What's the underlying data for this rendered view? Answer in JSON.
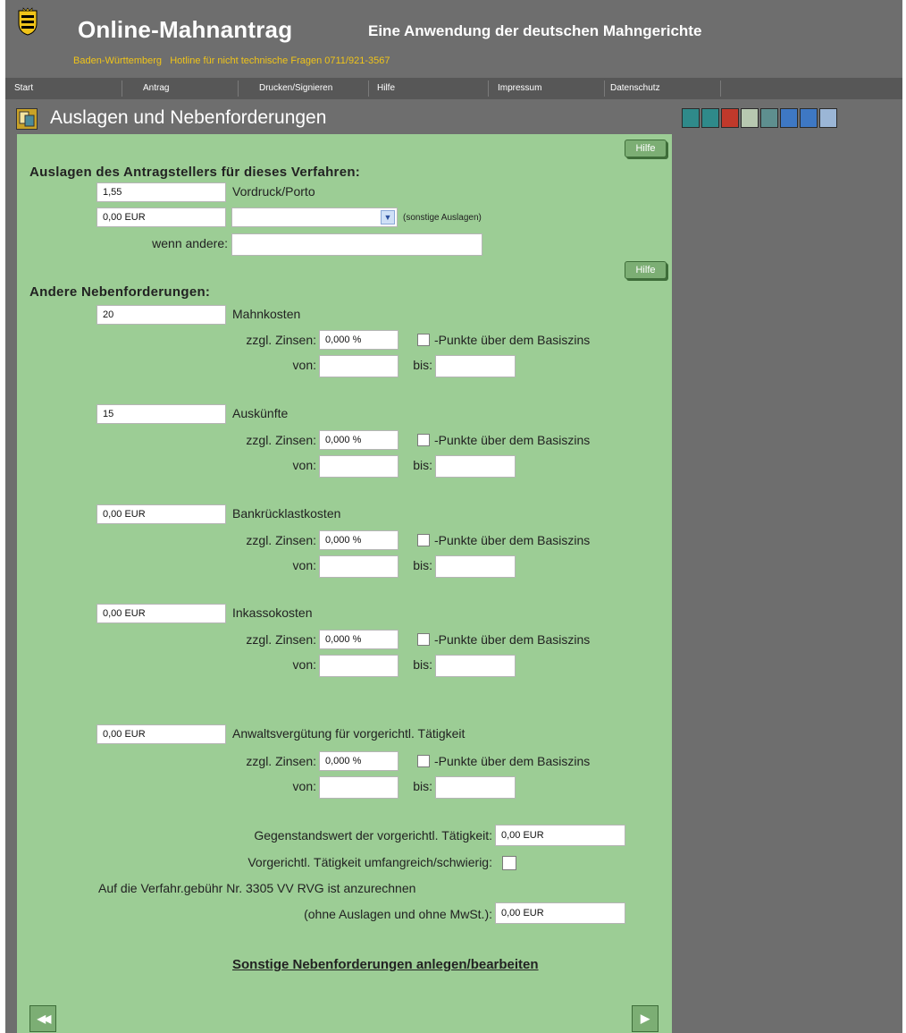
{
  "header": {
    "title": "Online-Mahnantrag",
    "subtitle": "Eine Anwendung der deutschen Mahngerichte",
    "region": "Baden-Württemberg",
    "hotline": "Hotline für nicht technische Fragen 0711/921-3567"
  },
  "nav": {
    "items": [
      "Start",
      "Antrag",
      "Drucken/Signieren",
      "Hilfe",
      "Impressum",
      "Datenschutz"
    ]
  },
  "section": {
    "title": "Auslagen und Nebenforderungen",
    "tools": [
      {
        "icon": "people-icon",
        "color": "#2f8a8a"
      },
      {
        "icon": "person-icon",
        "color": "#2f8a8a"
      },
      {
        "icon": "person-red-icon",
        "color": "#c0392b"
      },
      {
        "icon": "money-icon",
        "color": "#b7c8b0"
      },
      {
        "icon": "globe-icon",
        "color": "#5e8f8f"
      },
      {
        "icon": "list-icon",
        "color": "#3e78c4"
      },
      {
        "icon": "document-icon",
        "color": "#3e78c4"
      },
      {
        "icon": "save-icon",
        "color": "#9bb6d6"
      }
    ]
  },
  "help_label": "Hilfe",
  "auslagen": {
    "heading": "Auslagen des Antragstellers für dieses Verfahren:",
    "vordruck_value": "1,55",
    "vordruck_label": "Vordruck/Porto",
    "sonstige_value": "0,00 EUR",
    "sonstige_select": "",
    "sonstige_label": "(sonstige Auslagen)",
    "wenn_andere_label": "wenn andere:",
    "wenn_andere_value": ""
  },
  "neben": {
    "heading": "Andere Nebenforderungen:",
    "zinsen_label": "zzgl. Zinsen:",
    "punkte_label": "-Punkte über dem Basiszins",
    "von_label": "von:",
    "bis_label": "bis:",
    "rows": [
      {
        "amount": "20",
        "label": "Mahnkosten",
        "zins": "0,000 %",
        "von": "",
        "bis": ""
      },
      {
        "amount": "15",
        "label": "Auskünfte",
        "zins": "0,000 %",
        "von": "",
        "bis": ""
      },
      {
        "amount": "0,00 EUR",
        "label": "Bankrücklastkosten",
        "zins": "0,000 %",
        "von": "",
        "bis": ""
      },
      {
        "amount": "0,00 EUR",
        "label": "Inkassokosten",
        "zins": "0,000 %",
        "von": "",
        "bis": ""
      },
      {
        "amount": "0,00 EUR",
        "label": "Anwaltsvergütung für vorgerichtl. Tätigkeit",
        "zins": "0,000 %",
        "von": "",
        "bis": ""
      }
    ]
  },
  "vorgericht": {
    "gegenstand_label": "Gegenstandswert der vorgerichtl. Tätigkeit:",
    "gegenstand_value": "0,00 EUR",
    "umfang_label": "Vorgerichtl. Tätigkeit umfangreich/schwierig:",
    "anrechnen_line1": "Auf die Verfahr.gebühr Nr. 3305 VV RVG ist anzurechnen",
    "anrechnen_line2": "(ohne Auslagen und ohne MwSt.):",
    "anrechnen_value": "0,00 EUR"
  },
  "sonstige_link": "Sonstige Nebenforderungen anlegen/bearbeiten",
  "buttons": {
    "back_glyph": "◀◀",
    "next_glyph": "▶"
  }
}
